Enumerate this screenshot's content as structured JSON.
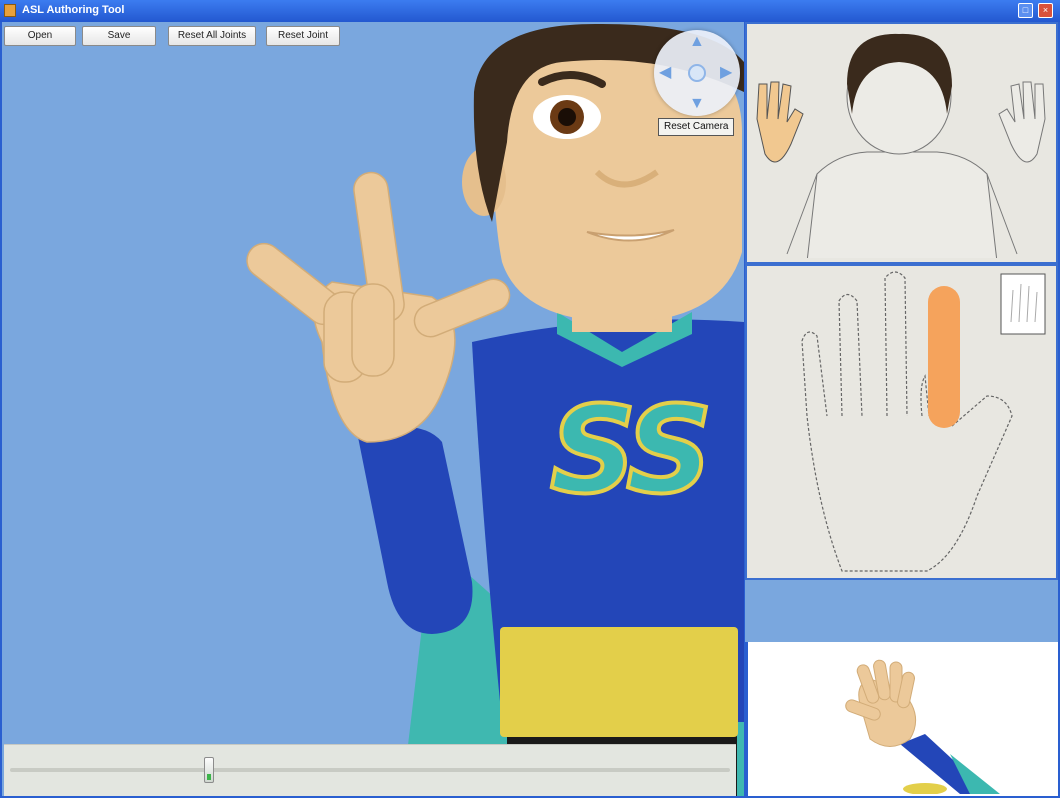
{
  "window": {
    "title": "ASL Authoring Tool",
    "minimize_glyph": "□",
    "close_glyph": "×"
  },
  "toolbar": {
    "open_label": "Open",
    "save_label": "Save",
    "reset_all_label": "Reset All Joints",
    "reset_joint_label": "Reset Joint"
  },
  "camera": {
    "reset_label": "Reset Camera",
    "icons": [
      "arrow-up-icon",
      "arrow-down-icon",
      "arrow-left-icon",
      "arrow-right-icon",
      "hand-pan-icon"
    ]
  },
  "avatar": {
    "shirt_logo": "SS",
    "skin_color": "#ecc99a",
    "shirt_color": "#2346b8",
    "collar_color": "#3cb8b0",
    "belt_color": "#e3cf4a",
    "background_color": "#7aa7de",
    "highlight_finger_color": "#f5a35c"
  },
  "timeline": {
    "position": 0.27
  }
}
